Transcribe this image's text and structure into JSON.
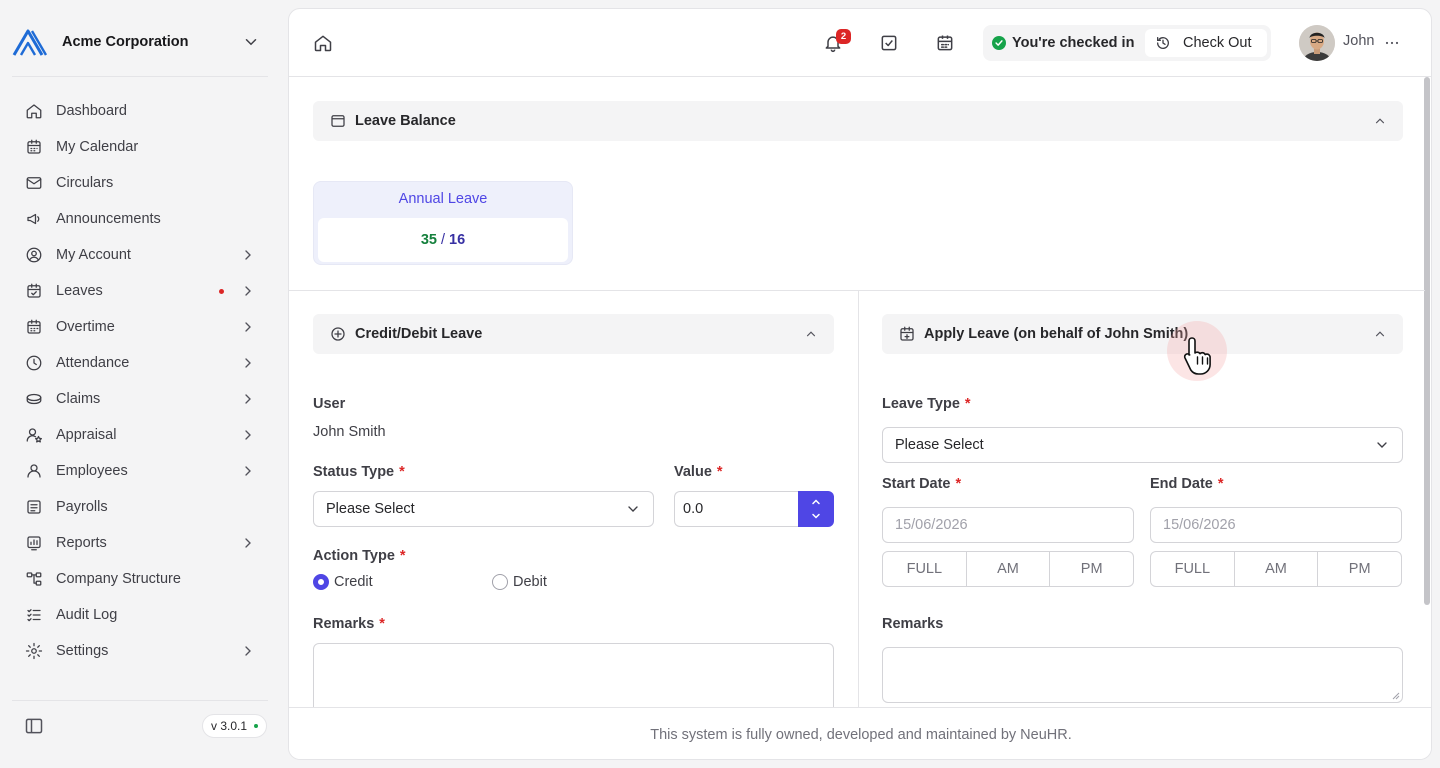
{
  "brand": {
    "name": "Acme Corporation"
  },
  "sidebar": {
    "items": [
      {
        "label": "Dashboard",
        "icon": "home-icon",
        "chevron": false,
        "dot": false
      },
      {
        "label": "My Calendar",
        "icon": "calendar-icon",
        "chevron": false,
        "dot": false
      },
      {
        "label": "Circulars",
        "icon": "mail-icon",
        "chevron": false,
        "dot": false
      },
      {
        "label": "Announcements",
        "icon": "megaphone-icon",
        "chevron": false,
        "dot": false
      },
      {
        "label": "My Account",
        "icon": "user-circle-icon",
        "chevron": true,
        "dot": false
      },
      {
        "label": "Leaves",
        "icon": "calendar-check-icon",
        "chevron": true,
        "dot": true
      },
      {
        "label": "Overtime",
        "icon": "calendar-clock-icon",
        "chevron": true,
        "dot": false
      },
      {
        "label": "Attendance",
        "icon": "clock-icon",
        "chevron": true,
        "dot": false
      },
      {
        "label": "Claims",
        "icon": "coins-icon",
        "chevron": true,
        "dot": false
      },
      {
        "label": "Appraisal",
        "icon": "user-star-icon",
        "chevron": true,
        "dot": false
      },
      {
        "label": "Employees",
        "icon": "user-icon",
        "chevron": true,
        "dot": false
      },
      {
        "label": "Payrolls",
        "icon": "receipt-icon",
        "chevron": false,
        "dot": false
      },
      {
        "label": "Reports",
        "icon": "chart-icon",
        "chevron": true,
        "dot": false
      },
      {
        "label": "Company Structure",
        "icon": "org-chart-icon",
        "chevron": false,
        "dot": false
      },
      {
        "label": "Audit Log",
        "icon": "list-check-icon",
        "chevron": false,
        "dot": false
      },
      {
        "label": "Settings",
        "icon": "gear-icon",
        "chevron": true,
        "dot": false
      }
    ],
    "version": "v 3.0.1"
  },
  "topbar": {
    "notification_count": "2",
    "checkin_status": "You're checked in",
    "checkout_label": "Check Out",
    "user_name": "John"
  },
  "leave_balance": {
    "title": "Leave Balance",
    "card_title": "Annual Leave",
    "used": "35",
    "separator": "/",
    "total": "16"
  },
  "credit_debit": {
    "title": "Credit/Debit Leave",
    "user_label": "User",
    "user_value": "John Smith",
    "status_type_label": "Status Type",
    "status_type_value": "Please Select",
    "value_label": "Value",
    "value_value": "0.0",
    "action_type_label": "Action Type",
    "action_options": [
      "Credit",
      "Debit"
    ],
    "action_selected": "Credit",
    "remarks_label": "Remarks",
    "required_mark": "*"
  },
  "apply_leave": {
    "title": "Apply Leave (on behalf of John Smith)",
    "leave_type_label": "Leave Type",
    "leave_type_value": "Please Select",
    "start_date_label": "Start Date",
    "start_date_placeholder": "15/06/2026",
    "end_date_label": "End Date",
    "end_date_placeholder": "15/06/2026",
    "day_parts": [
      "FULL",
      "AM",
      "PM"
    ],
    "remarks_label": "Remarks",
    "required_mark": "*"
  },
  "footer": {
    "text": "This system is fully owned, developed and maintained by NeuHR."
  }
}
